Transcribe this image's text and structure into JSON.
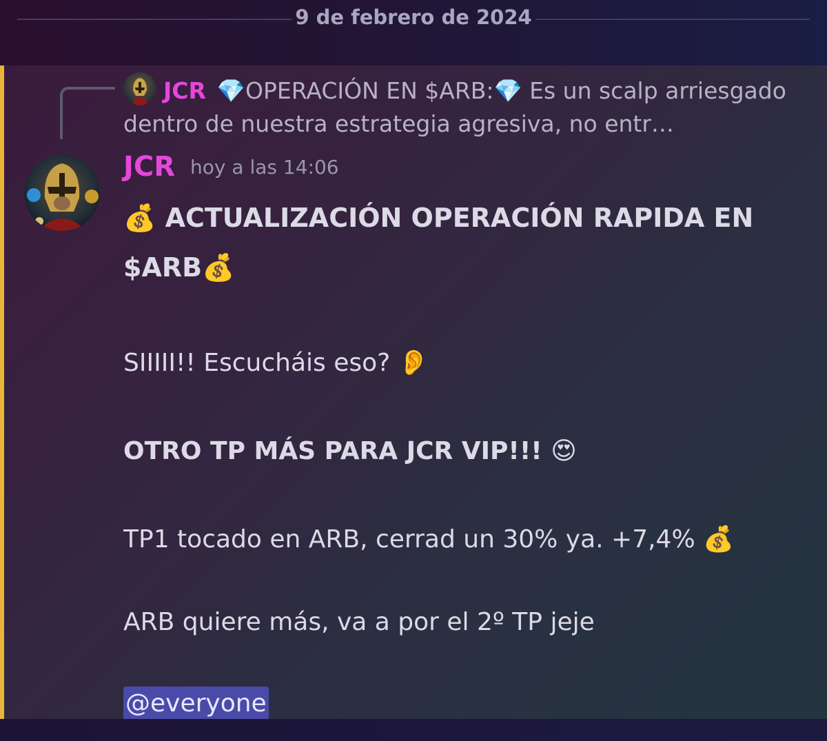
{
  "date_divider": "9 de febrero de 2024",
  "reply": {
    "author": "JCR",
    "emoji_left": "💎",
    "text_a": "OPERACIÓN EN $ARB:",
    "emoji_right": "💎",
    "text_b": "Es un scalp arriesgado dentro de nuestra estrategia agresiva, no entr…"
  },
  "message": {
    "author": "JCR",
    "timestamp": "hoy a las 14:06",
    "headline_emoji_start": "💰",
    "headline": "ACTUALIZACIÓN OPERACIÓN RAPIDA EN $ARB",
    "headline_emoji_end": "💰",
    "line1": "SIIIII!! Escucháis eso?",
    "line1_emoji": "👂",
    "line2": "OTRO TP MÁS PARA JCR VIP!!!",
    "line2_emoji": "😍",
    "line3": "TP1 tocado en ARB, cerrad un 30% ya. +7,4%",
    "line3_emoji": "💰",
    "line4": "ARB quiere más, va a por el 2º TP jeje",
    "mention": "@everyone"
  },
  "colors": {
    "author": "#e447d9",
    "mention_bar": "#e8b53a",
    "mention_bg": "#4a4aa8"
  },
  "icons": {
    "avatar": "spartan-helmet-avatar",
    "reply_spine": "reply-connector"
  }
}
